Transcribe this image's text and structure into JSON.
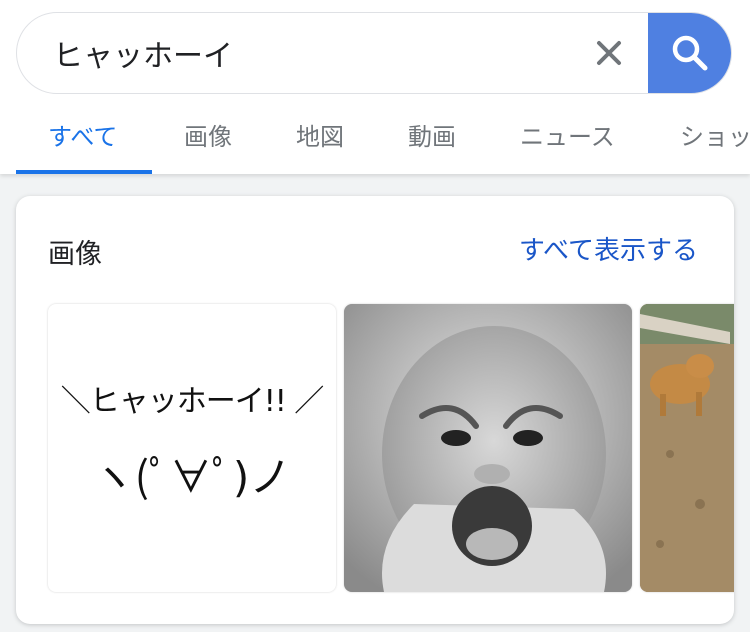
{
  "search": {
    "query": "ヒャッホーイ"
  },
  "tabs": [
    {
      "label": "すべて"
    },
    {
      "label": "画像"
    },
    {
      "label": "地図"
    },
    {
      "label": "動画"
    },
    {
      "label": "ニュース"
    },
    {
      "label": "ショッ"
    }
  ],
  "images_card": {
    "title": "画像",
    "view_all": "すべて表示する",
    "thumbs": [
      {
        "line1": "＼ヒャッホーイ!! ／",
        "line2": "ヽ(ﾟ∀ﾟ)ノ"
      },
      {
        "kind": "photo"
      },
      {
        "kind": "photo"
      }
    ]
  },
  "colors": {
    "accent": "#1a73e8",
    "search_button": "#4f80e1"
  }
}
